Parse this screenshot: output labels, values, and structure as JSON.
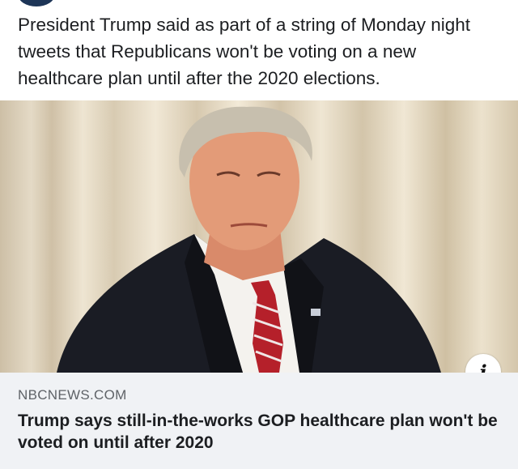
{
  "post": {
    "text": "President Trump said as part of a string of Monday night tweets that Republicans won't be voting on a new healthcare plan until after the 2020 elections."
  },
  "link_preview": {
    "domain": "NBCNEWS.COM",
    "headline": "Trump says still-in-the-works GOP healthcare plan won't be voted on until after 2020",
    "info_icon": "i"
  },
  "icons": {
    "info": "info-icon"
  },
  "colors": {
    "link_box_bg": "#f0f2f5",
    "domain_text": "#5f6368"
  }
}
